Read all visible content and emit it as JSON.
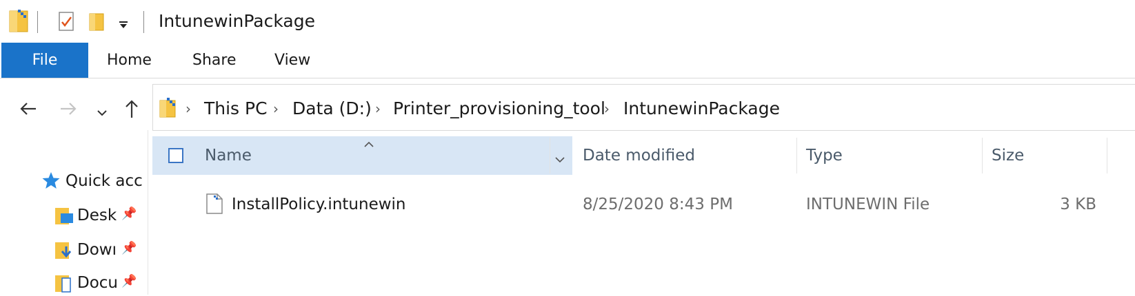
{
  "window": {
    "title": "IntunewinPackage"
  },
  "quick_access_toolbar": {
    "icons": [
      "folder-icon",
      "properties-checkmark-icon",
      "new-folder-icon",
      "customize-dropdown-icon"
    ]
  },
  "ribbon": {
    "tabs": [
      {
        "label": "File",
        "active": true
      },
      {
        "label": "Home"
      },
      {
        "label": "Share"
      },
      {
        "label": "View"
      }
    ],
    "file_tab_color": "#1a73c9"
  },
  "navigation": {
    "back_icon": "arrow-left-icon",
    "forward_icon": "arrow-right-icon",
    "recent_icon": "chevron-down-icon",
    "up_icon": "arrow-up-icon"
  },
  "breadcrumb": [
    "This PC",
    "Data (D:)",
    "Printer_provisioning_tool",
    "IntunewinPackage"
  ],
  "nav_pane": {
    "items": [
      {
        "label": "Quick acc",
        "icon": "star-icon"
      },
      {
        "label": "Desk",
        "icon": "desktop-folder-icon",
        "pinned": true
      },
      {
        "label": "Dowı",
        "icon": "downloads-folder-icon",
        "pinned": true
      },
      {
        "label": "Docu",
        "icon": "documents-folder-icon",
        "pinned": true
      }
    ]
  },
  "columns": {
    "name": "Name",
    "date": "Date modified",
    "type": "Type",
    "size": "Size"
  },
  "files": [
    {
      "name": "InstallPolicy.intunewin",
      "date": "8/25/2020 8:43 PM",
      "type": "INTUNEWIN File",
      "size": "3 KB",
      "icon": "generic-file-icon"
    }
  ],
  "colors": {
    "accent": "#1a73c9",
    "header_selected": "#d8e6f5",
    "folder": "#f5c342"
  }
}
